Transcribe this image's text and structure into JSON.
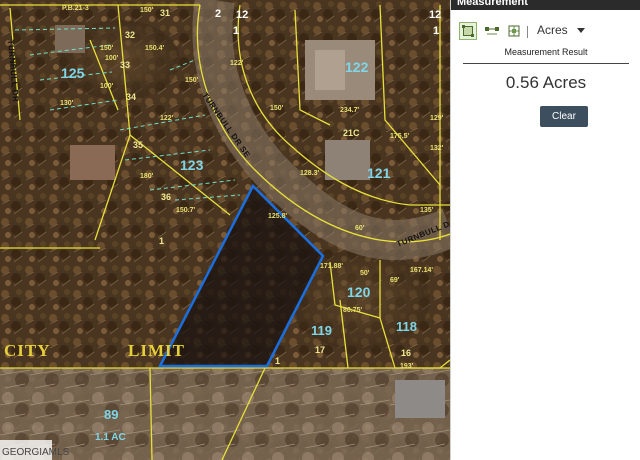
{
  "panel": {
    "title": "Measurement",
    "unit": "Acres",
    "result_label": "Measurement Result",
    "result_value": "0.56 Acres",
    "clear_label": "Clear"
  },
  "map": {
    "street_main": "TURNBULL DR SE",
    "street_right": "TURNBULL D",
    "street_left": "TURNBULL DR",
    "city_limit_left": "CITY",
    "city_limit_right": "LIMIT",
    "parcels": {
      "p125": "125",
      "p123": "123",
      "p122": "122",
      "p121": "121",
      "p120": "120",
      "p119": "119",
      "p118": "118",
      "p89": "89",
      "p89_area": "1.1 AC"
    },
    "lots": {
      "l31": "31",
      "l32": "32",
      "l33": "33",
      "l34": "34",
      "l35": "35",
      "l36": "36",
      "l21c": "21C",
      "l17": "17",
      "l16": "16",
      "l1a": "1",
      "l1b": "1",
      "l2": "2",
      "l12a": "12",
      "l12b": "12",
      "l1c": "1",
      "l1d": "1"
    },
    "dims": {
      "d1": "P.B.21-3",
      "d2": "150'",
      "d3": "150'",
      "d4": "150.4'",
      "d5": "130'",
      "d6": "122'",
      "d7": "150'",
      "d8": "180'",
      "d9": "150.7'",
      "d10": "125.8'",
      "d11": "122'",
      "d12": "234.7'",
      "d13": "128.3'",
      "d14": "60'",
      "d15": "175.5'",
      "d16": "135'",
      "d17": "171.88'",
      "d18": "167.14'",
      "d19": "50'",
      "d20": "69'",
      "d21": "80.75'",
      "d22": "193'",
      "d23": "100'",
      "d24": "100'",
      "d25": "129'",
      "d26": "132'",
      "d27": "150'"
    },
    "watermark": "GEORGIAMLS"
  },
  "colors": {
    "parcel_line": "#e8e03a",
    "lot_dash": "#6fe0c8",
    "selection": "#1a6fe0",
    "panel_button": "#3d4e5f",
    "parcel_number": "#7fd6e8"
  },
  "icons": [
    "area-measure-icon",
    "distance-measure-icon",
    "location-measure-icon",
    "caret-down-icon"
  ]
}
